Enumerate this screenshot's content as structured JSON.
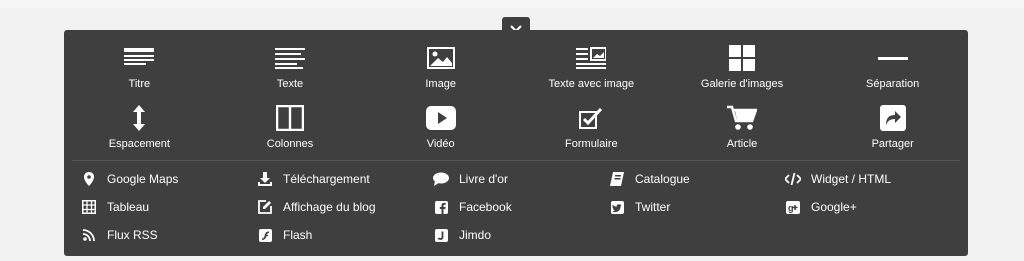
{
  "close": {
    "icon": "close-icon"
  },
  "tiles": [
    {
      "label": "Titre",
      "icon": "title-icon"
    },
    {
      "label": "Texte",
      "icon": "text-icon"
    },
    {
      "label": "Image",
      "icon": "image-icon"
    },
    {
      "label": "Texte avec image",
      "icon": "text-with-image-icon"
    },
    {
      "label": "Galerie d'images",
      "icon": "gallery-icon"
    },
    {
      "label": "Séparation",
      "icon": "separator-icon"
    },
    {
      "label": "Espacement",
      "icon": "spacing-icon"
    },
    {
      "label": "Colonnes",
      "icon": "columns-icon"
    },
    {
      "label": "Vidéo",
      "icon": "video-icon"
    },
    {
      "label": "Formulaire",
      "icon": "form-icon"
    },
    {
      "label": "Article",
      "icon": "cart-icon"
    },
    {
      "label": "Partager",
      "icon": "share-icon"
    }
  ],
  "links": [
    {
      "label": "Google Maps",
      "icon": "map-pin-icon"
    },
    {
      "label": "Téléchargement",
      "icon": "download-icon"
    },
    {
      "label": "Livre d'or",
      "icon": "speech-bubble-icon"
    },
    {
      "label": "Catalogue",
      "icon": "book-icon"
    },
    {
      "label": "Widget / HTML",
      "icon": "code-icon"
    },
    {
      "label": "Tableau",
      "icon": "table-icon"
    },
    {
      "label": "Affichage du blog",
      "icon": "edit-icon"
    },
    {
      "label": "Facebook",
      "icon": "facebook-icon"
    },
    {
      "label": "Twitter",
      "icon": "twitter-icon"
    },
    {
      "label": "Google+",
      "icon": "google-plus-icon"
    },
    {
      "label": "Flux RSS",
      "icon": "rss-icon"
    },
    {
      "label": "Flash",
      "icon": "flash-icon"
    },
    {
      "label": "Jimdo",
      "icon": "jimdo-icon"
    }
  ],
  "colors": {
    "panel": "#3f3f3f",
    "background": "#f2f2f2",
    "text": "#ffffff"
  }
}
